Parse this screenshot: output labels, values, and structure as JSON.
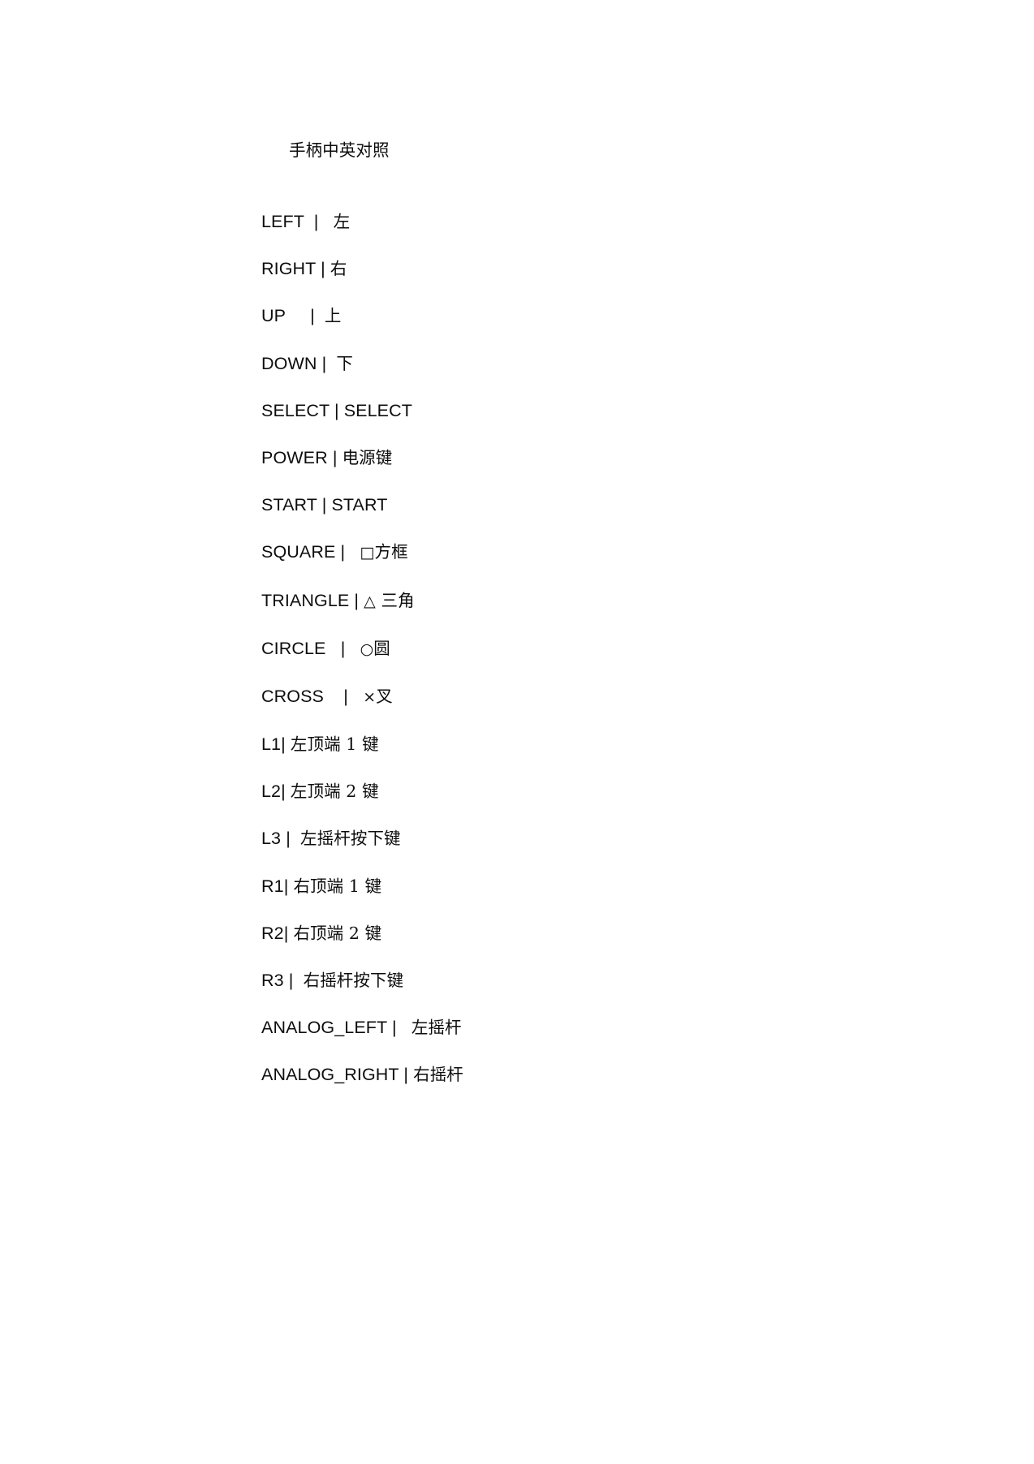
{
  "document": {
    "title": "手柄中英对照",
    "page_background": "#ffffff",
    "text_color": "#0d0d0d",
    "separator": "|",
    "lines": [
      {
        "key": "LEFT",
        "pre_gap": "  ",
        "sep": "|",
        "post_gap": "   ",
        "glyph": "",
        "value": "左",
        "full": "LEFT  |   左"
      },
      {
        "key": "RIGHT",
        "pre_gap": " ",
        "sep": "|",
        "post_gap": " ",
        "glyph": "",
        "value": "右",
        "full": "RIGHT | 右"
      },
      {
        "key": "UP",
        "pre_gap": "     ",
        "sep": "|",
        "post_gap": "  ",
        "glyph": "",
        "value": "上",
        "full": "UP      |  上"
      },
      {
        "key": "DOWN",
        "pre_gap": " ",
        "sep": "|",
        "post_gap": "  ",
        "glyph": "",
        "value": "下",
        "full": "DOWN |  下"
      },
      {
        "key": "SELECT",
        "pre_gap": " ",
        "sep": "|",
        "post_gap": " ",
        "glyph": "",
        "value": "SELECT",
        "full": "SELECT | SELECT"
      },
      {
        "key": "POWER",
        "pre_gap": " ",
        "sep": "|",
        "post_gap": " ",
        "glyph": "",
        "value": "电源键",
        "full": "POWER | 电源键"
      },
      {
        "key": "START",
        "pre_gap": " ",
        "sep": "|",
        "post_gap": " ",
        "glyph": "",
        "value": "START",
        "full": "START | START"
      },
      {
        "key": "SQUARE",
        "pre_gap": " ",
        "sep": "|",
        "post_gap": "   ",
        "glyph": "□",
        "value": "方框",
        "full": "SQUARE |   □方框"
      },
      {
        "key": "TRIANGLE",
        "pre_gap": " ",
        "sep": "|",
        "post_gap": " ",
        "glyph": "△",
        "value": " 三角",
        "full": "TRIANGLE | △ 三角"
      },
      {
        "key": "CIRCLE",
        "pre_gap": "   ",
        "sep": "|",
        "post_gap": "   ",
        "glyph": "○",
        "value": "圆",
        "full": "CIRCLE   |   ○圆"
      },
      {
        "key": "CROSS",
        "pre_gap": "    ",
        "sep": "|",
        "post_gap": "   ",
        "glyph": "×",
        "value": "叉",
        "full": "CROSS    |   ×叉"
      },
      {
        "key": "L1",
        "pre_gap": "",
        "sep": "|",
        "post_gap": " ",
        "glyph": "",
        "value": "左顶端 1 键",
        "full": "L1| 左顶端 1 键"
      },
      {
        "key": "L2",
        "pre_gap": "",
        "sep": "|",
        "post_gap": " ",
        "glyph": "",
        "value": "左顶端 2 键",
        "full": "L2| 左顶端 2 键"
      },
      {
        "key": "L3",
        "pre_gap": " ",
        "sep": "|",
        "post_gap": "  ",
        "glyph": "",
        "value": "左摇杆按下键",
        "full": "L3 |  左摇杆按下键"
      },
      {
        "key": "R1",
        "pre_gap": "",
        "sep": "|",
        "post_gap": " ",
        "glyph": "",
        "value": "右顶端 1 键",
        "full": "R1| 右顶端 1 键"
      },
      {
        "key": "R2",
        "pre_gap": "",
        "sep": "|",
        "post_gap": " ",
        "glyph": "",
        "value": "右顶端 2 键",
        "full": "R2| 右顶端 2 键"
      },
      {
        "key": "R3",
        "pre_gap": " ",
        "sep": "|",
        "post_gap": "  ",
        "glyph": "",
        "value": "右摇杆按下键",
        "full": "R3 |  右摇杆按下键"
      },
      {
        "key": "ANALOG_LEFT",
        "pre_gap": " ",
        "sep": "|",
        "post_gap": "   ",
        "glyph": "",
        "value": "左摇杆",
        "full": "ANALOG_LEFT |   左摇杆"
      },
      {
        "key": "ANALOG_RIGHT",
        "pre_gap": " ",
        "sep": "|",
        "post_gap": " ",
        "glyph": "",
        "value": "右摇杆",
        "full": "ANALOG_RIGHT | 右摇杆"
      }
    ]
  }
}
